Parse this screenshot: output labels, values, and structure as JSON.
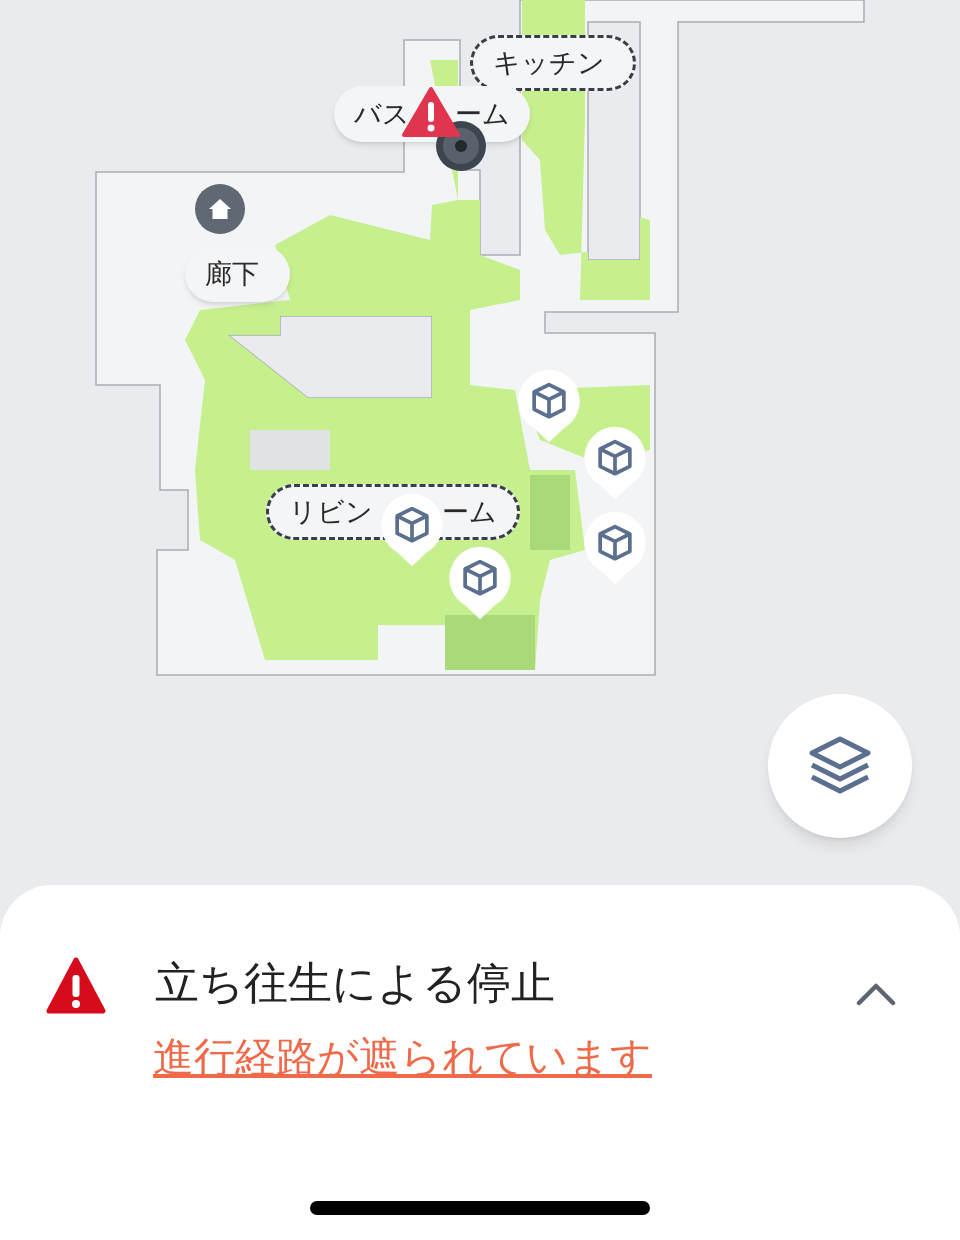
{
  "map": {
    "rooms": [
      {
        "parts": [
          "キッチン"
        ],
        "selected": true
      },
      {
        "parts": [
          "バス",
          "ーム"
        ],
        "selected": false
      },
      {
        "parts": [
          "廊下"
        ],
        "selected": false
      },
      {
        "parts": [
          "リビン",
          "ーム"
        ],
        "selected": true
      }
    ]
  },
  "status": {
    "title": "立ち往生による停止",
    "link": "進行経路が遮られています",
    "expanded": true
  }
}
